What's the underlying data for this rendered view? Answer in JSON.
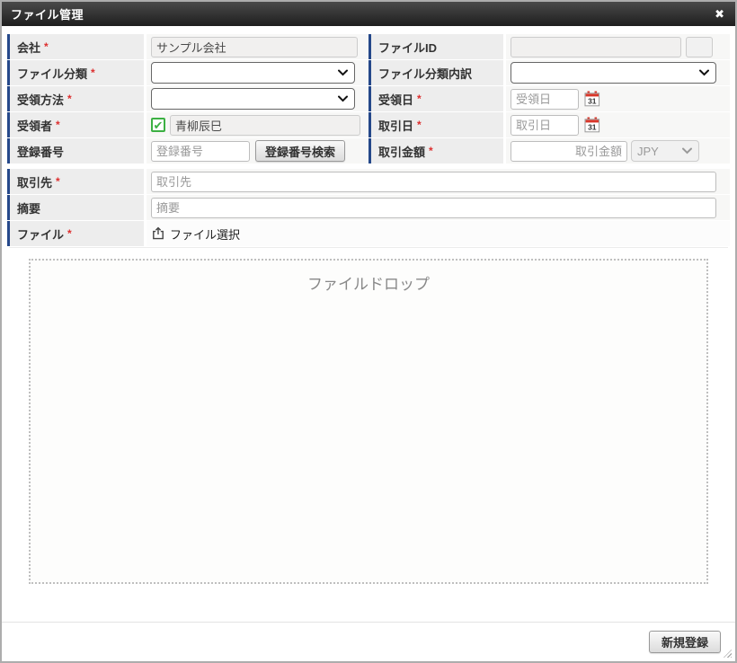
{
  "modal": {
    "title": "ファイル管理",
    "close_glyph": "✖"
  },
  "required_marker": "*",
  "fields": {
    "company": {
      "label": "会社",
      "required": true,
      "value": "サンプル会社"
    },
    "file_id": {
      "label": "ファイルID"
    },
    "file_category": {
      "label": "ファイル分類",
      "required": true
    },
    "file_category_detail": {
      "label": "ファイル分類内訳"
    },
    "receipt_method": {
      "label": "受領方法",
      "required": true
    },
    "receipt_date": {
      "label": "受領日",
      "required": true,
      "placeholder": "受領日"
    },
    "recipient": {
      "label": "受領者",
      "required": true,
      "value": "青柳辰巳",
      "checked_glyph": "✔"
    },
    "transaction_date": {
      "label": "取引日",
      "required": true,
      "placeholder": "取引日"
    },
    "registration_number": {
      "label": "登録番号",
      "placeholder": "登録番号",
      "search_button": "登録番号検索"
    },
    "transaction_amount": {
      "label": "取引金額",
      "required": true,
      "placeholder": "取引金額",
      "currency": "JPY"
    },
    "client": {
      "label": "取引先",
      "required": true,
      "placeholder": "取引先"
    },
    "summary": {
      "label": "摘要",
      "placeholder": "摘要"
    },
    "file": {
      "label": "ファイル",
      "required": true,
      "select_label": "ファイル選択"
    }
  },
  "file_drop": {
    "label": "ファイルドロップ"
  },
  "footer": {
    "submit_label": "新規登録"
  },
  "colors": {
    "accent_bar": "#25488a",
    "required": "#dd2f2f",
    "titlebar": "#2b2b2b",
    "label_bg": "#ededed",
    "checkbox_green": "#3cb043",
    "calendar_red": "#d9372a"
  }
}
